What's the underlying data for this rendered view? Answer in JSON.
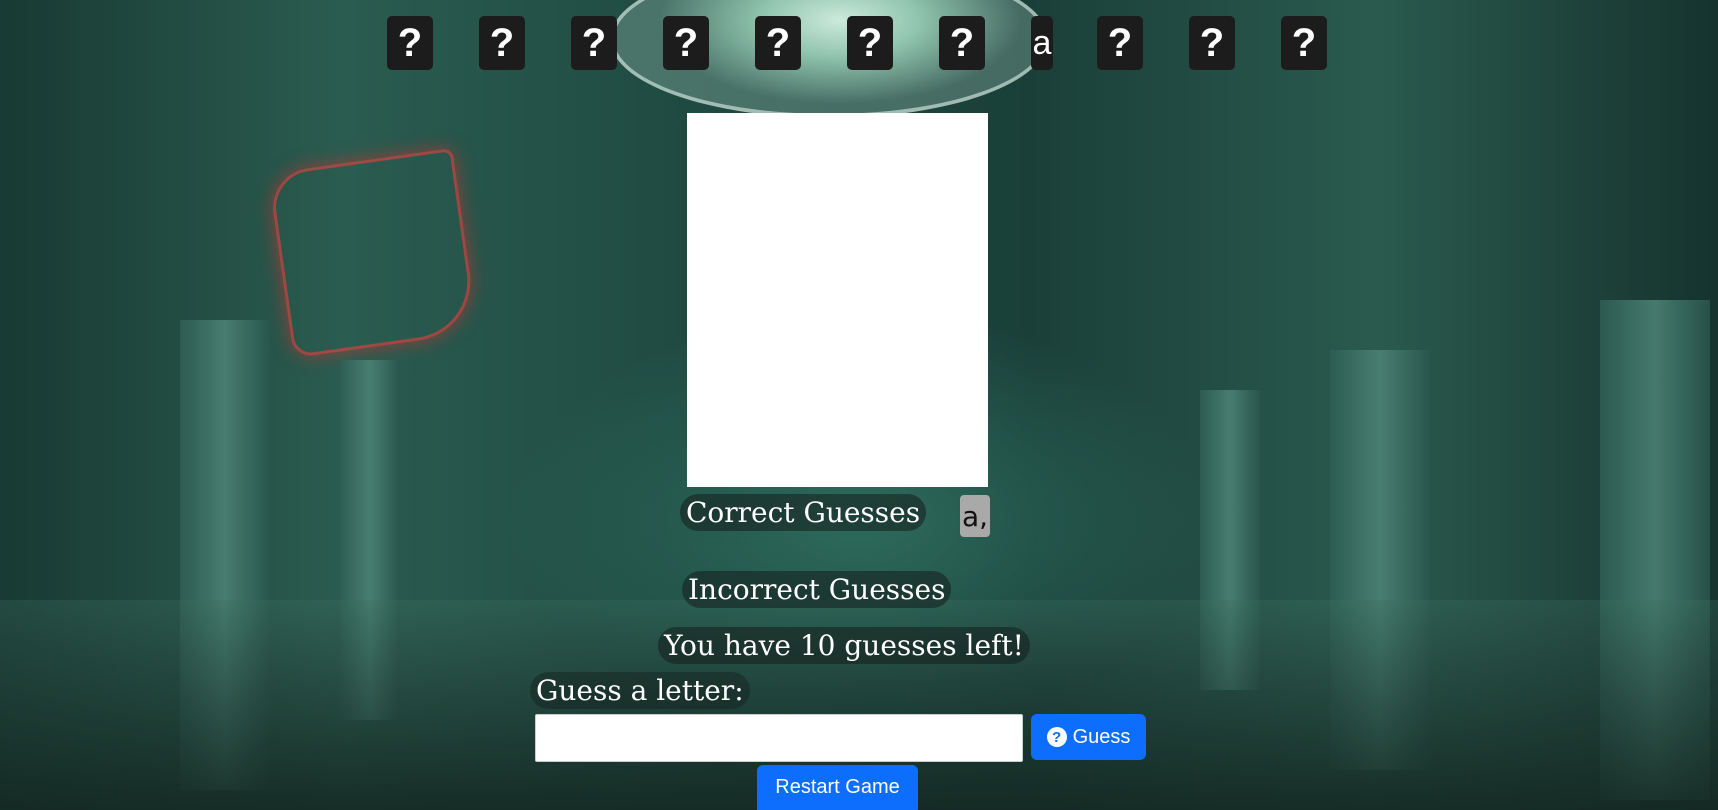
{
  "word_tiles": [
    "?",
    "?",
    "?",
    "?",
    "?",
    "?",
    "?",
    "a",
    "?",
    "?",
    "?"
  ],
  "correct": {
    "label": "Correct Guesses",
    "letters": "a,"
  },
  "incorrect": {
    "label": "Incorrect Guesses"
  },
  "status": {
    "text": "You have 10 guesses left!"
  },
  "form": {
    "label": "Guess a letter:",
    "input_value": "",
    "guess_button": "Guess",
    "guess_icon": "question-circle-icon"
  },
  "restart": {
    "label": "Restart Game"
  },
  "colors": {
    "button": "#0d6efd",
    "tile": "#1c1c1c",
    "correct_badge": "#a9a9a9"
  }
}
